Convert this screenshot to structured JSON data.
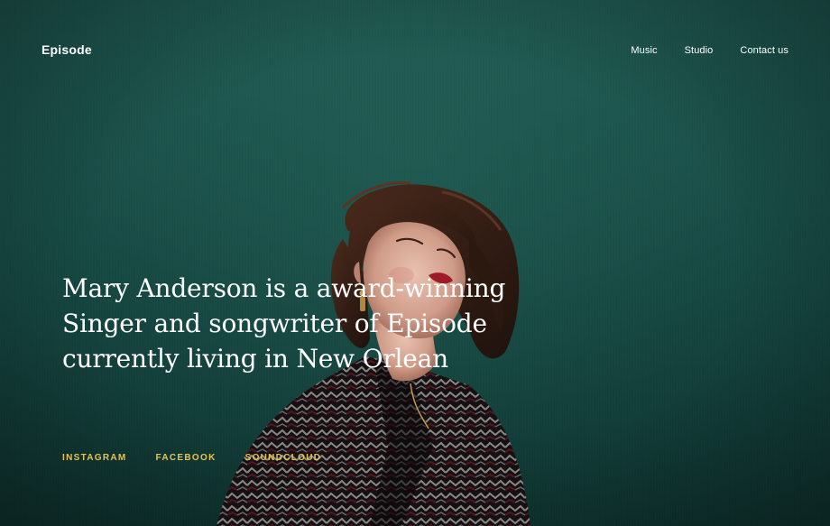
{
  "header": {
    "logo": "Episode",
    "nav": [
      {
        "label": "Music"
      },
      {
        "label": "Studio"
      },
      {
        "label": "Contact us"
      }
    ]
  },
  "hero": {
    "heading": "Mary Anderson is a award-winning Singer and songwriter of Episode currently living in New Orlean"
  },
  "social_links": [
    {
      "label": "INSTAGRAM"
    },
    {
      "label": "FACEBOOK"
    },
    {
      "label": "SOUNDCLOUD"
    }
  ],
  "colors": {
    "background": "#174a44",
    "accent": "#e7c34f",
    "text": "#ffffff"
  }
}
